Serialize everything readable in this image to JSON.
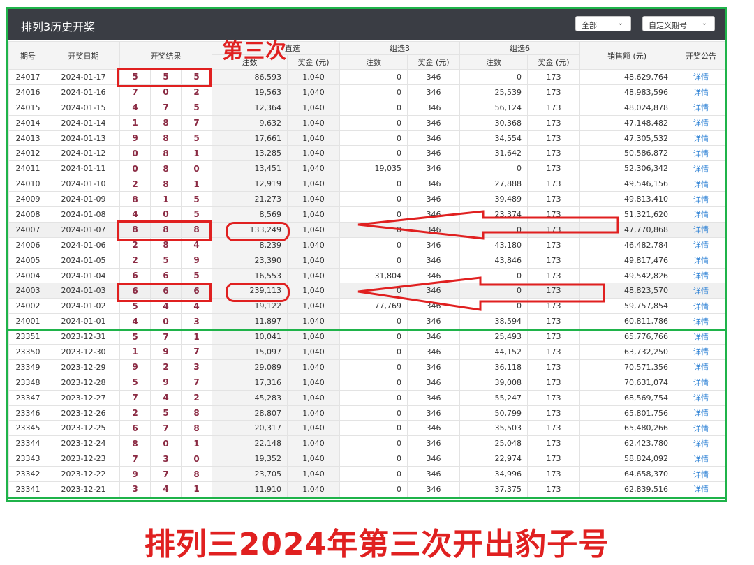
{
  "header": {
    "title": "排列3历史开奖",
    "filter_select": "全部",
    "period_select": "自定义期号"
  },
  "columns": {
    "period": "期号",
    "date": "开奖日期",
    "result": "开奖结果",
    "zhixuan": "直选",
    "group3": "组选3",
    "group6": "组选6",
    "count": "注数",
    "prize": "奖金 (元)",
    "sales": "销售额 (元)",
    "notice": "开奖公告"
  },
  "rows": [
    [
      "24017",
      "2024-01-17",
      "5",
      "5",
      "5",
      "86,593",
      "1,040",
      "0",
      "346",
      "0",
      "173",
      "48,629,764",
      "详情"
    ],
    [
      "24016",
      "2024-01-16",
      "7",
      "0",
      "2",
      "19,563",
      "1,040",
      "0",
      "346",
      "25,539",
      "173",
      "48,983,596",
      "详情"
    ],
    [
      "24015",
      "2024-01-15",
      "4",
      "7",
      "5",
      "12,364",
      "1,040",
      "0",
      "346",
      "56,124",
      "173",
      "48,024,878",
      "详情"
    ],
    [
      "24014",
      "2024-01-14",
      "1",
      "8",
      "7",
      "9,632",
      "1,040",
      "0",
      "346",
      "30,368",
      "173",
      "47,148,482",
      "详情"
    ],
    [
      "24013",
      "2024-01-13",
      "9",
      "8",
      "5",
      "17,661",
      "1,040",
      "0",
      "346",
      "34,554",
      "173",
      "47,305,532",
      "详情"
    ],
    [
      "24012",
      "2024-01-12",
      "0",
      "8",
      "1",
      "13,285",
      "1,040",
      "0",
      "346",
      "31,642",
      "173",
      "50,586,872",
      "详情"
    ],
    [
      "24011",
      "2024-01-11",
      "0",
      "8",
      "0",
      "13,451",
      "1,040",
      "19,035",
      "346",
      "0",
      "173",
      "52,306,342",
      "详情"
    ],
    [
      "24010",
      "2024-01-10",
      "2",
      "8",
      "1",
      "12,919",
      "1,040",
      "0",
      "346",
      "27,888",
      "173",
      "49,546,156",
      "详情"
    ],
    [
      "24009",
      "2024-01-09",
      "8",
      "1",
      "5",
      "21,273",
      "1,040",
      "0",
      "346",
      "39,489",
      "173",
      "49,813,410",
      "详情"
    ],
    [
      "24008",
      "2024-01-08",
      "4",
      "0",
      "5",
      "8,569",
      "1,040",
      "0",
      "346",
      "23,374",
      "173",
      "51,321,620",
      "详情"
    ],
    [
      "24007",
      "2024-01-07",
      "8",
      "8",
      "8",
      "133,249",
      "1,040",
      "0",
      "346",
      "0",
      "173",
      "47,770,868",
      "详情"
    ],
    [
      "24006",
      "2024-01-06",
      "2",
      "8",
      "4",
      "8,239",
      "1,040",
      "0",
      "346",
      "43,180",
      "173",
      "46,482,784",
      "详情"
    ],
    [
      "24005",
      "2024-01-05",
      "2",
      "5",
      "9",
      "23,390",
      "1,040",
      "0",
      "346",
      "43,846",
      "173",
      "49,817,476",
      "详情"
    ],
    [
      "24004",
      "2024-01-04",
      "6",
      "6",
      "5",
      "16,553",
      "1,040",
      "31,804",
      "346",
      "0",
      "173",
      "49,542,826",
      "详情"
    ],
    [
      "24003",
      "2024-01-03",
      "6",
      "6",
      "6",
      "239,113",
      "1,040",
      "0",
      "346",
      "0",
      "173",
      "48,823,570",
      "详情"
    ],
    [
      "24002",
      "2024-01-02",
      "5",
      "4",
      "4",
      "19,122",
      "1,040",
      "77,769",
      "346",
      "0",
      "173",
      "59,757,854",
      "详情"
    ],
    [
      "24001",
      "2024-01-01",
      "4",
      "0",
      "3",
      "11,897",
      "1,040",
      "0",
      "346",
      "38,594",
      "173",
      "60,811,786",
      "详情"
    ],
    [
      "23351",
      "2023-12-31",
      "5",
      "7",
      "1",
      "10,041",
      "1,040",
      "0",
      "346",
      "25,493",
      "173",
      "65,776,766",
      "详情"
    ],
    [
      "23350",
      "2023-12-30",
      "1",
      "9",
      "7",
      "15,097",
      "1,040",
      "0",
      "346",
      "44,152",
      "173",
      "63,732,250",
      "详情"
    ],
    [
      "23349",
      "2023-12-29",
      "9",
      "2",
      "3",
      "29,089",
      "1,040",
      "0",
      "346",
      "36,118",
      "173",
      "70,571,356",
      "详情"
    ],
    [
      "23348",
      "2023-12-28",
      "5",
      "9",
      "7",
      "17,316",
      "1,040",
      "0",
      "346",
      "39,008",
      "173",
      "70,631,074",
      "详情"
    ],
    [
      "23347",
      "2023-12-27",
      "7",
      "4",
      "2",
      "45,283",
      "1,040",
      "0",
      "346",
      "55,247",
      "173",
      "68,569,754",
      "详情"
    ],
    [
      "23346",
      "2023-12-26",
      "2",
      "5",
      "8",
      "28,807",
      "1,040",
      "0",
      "346",
      "50,799",
      "173",
      "65,801,756",
      "详情"
    ],
    [
      "23345",
      "2023-12-25",
      "6",
      "7",
      "8",
      "20,317",
      "1,040",
      "0",
      "346",
      "35,503",
      "173",
      "65,480,266",
      "详情"
    ],
    [
      "23344",
      "2023-12-24",
      "8",
      "0",
      "1",
      "22,148",
      "1,040",
      "0",
      "346",
      "25,048",
      "173",
      "62,423,780",
      "详情"
    ],
    [
      "23343",
      "2023-12-23",
      "7",
      "3",
      "0",
      "19,352",
      "1,040",
      "0",
      "346",
      "22,974",
      "173",
      "58,824,092",
      "详情"
    ],
    [
      "23342",
      "2023-12-22",
      "9",
      "7",
      "8",
      "23,705",
      "1,040",
      "0",
      "346",
      "34,996",
      "173",
      "64,658,370",
      "详情"
    ],
    [
      "23341",
      "2023-12-21",
      "3",
      "4",
      "1",
      "11,910",
      "1,040",
      "0",
      "346",
      "37,375",
      "173",
      "62,839,516",
      "详情"
    ]
  ],
  "annotations": {
    "overlay_label": "第三次",
    "caption": "排列三2024年第三次开出豹子号",
    "color": "#e02020",
    "frame_color": "#1fb34a",
    "highlighted_periods": [
      "24017",
      "24007",
      "24003"
    ]
  }
}
